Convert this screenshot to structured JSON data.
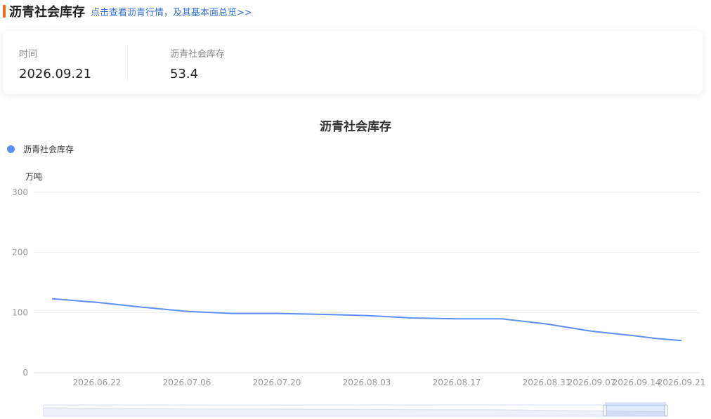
{
  "header": {
    "title": "沥青社会库存",
    "link_text": "点击查看沥青行情，及其基本面总览>>"
  },
  "summary": {
    "date_label": "时间",
    "date_value": "2026.09.21",
    "metric_label": "沥青社会库存",
    "metric_value": "53.4"
  },
  "colors": {
    "accent": "#f56b1d",
    "series": "#5b8ff9",
    "link": "#2f6fd6"
  },
  "chart_data": {
    "type": "line",
    "title": "沥青社会库存",
    "ylabel": "万吨",
    "xlabel": "",
    "ylim": [
      0,
      300
    ],
    "y_ticks": [
      0,
      100,
      200,
      300
    ],
    "x_tick_labels": [
      "2026.06.22",
      "2026.07.06",
      "2026.07.20",
      "2026.08.03",
      "2026.08.17",
      "2026.08.31",
      "2026.09.07",
      "2026.09.14",
      "2026.09.21"
    ],
    "legend_position": "top-left",
    "grid": true,
    "series": [
      {
        "name": "沥青社会库存",
        "points": [
          {
            "x": "2026.06.15",
            "y": 123
          },
          {
            "x": "2026.06.22",
            "y": 117
          },
          {
            "x": "2026.06.29",
            "y": 109
          },
          {
            "x": "2026.07.06",
            "y": 102
          },
          {
            "x": "2026.07.13",
            "y": 98.5
          },
          {
            "x": "2026.07.20",
            "y": 98.5
          },
          {
            "x": "2026.07.27",
            "y": 97
          },
          {
            "x": "2026.08.03",
            "y": 95
          },
          {
            "x": "2026.08.10",
            "y": 91
          },
          {
            "x": "2026.08.17",
            "y": 89.5
          },
          {
            "x": "2026.08.24",
            "y": 89.5
          },
          {
            "x": "2026.08.31",
            "y": 81
          },
          {
            "x": "2026.09.07",
            "y": 69
          },
          {
            "x": "2026.09.14",
            "y": 61
          },
          {
            "x": "2026.09.17",
            "y": 57
          },
          {
            "x": "2026.09.21",
            "y": 53.4
          }
        ]
      }
    ]
  }
}
